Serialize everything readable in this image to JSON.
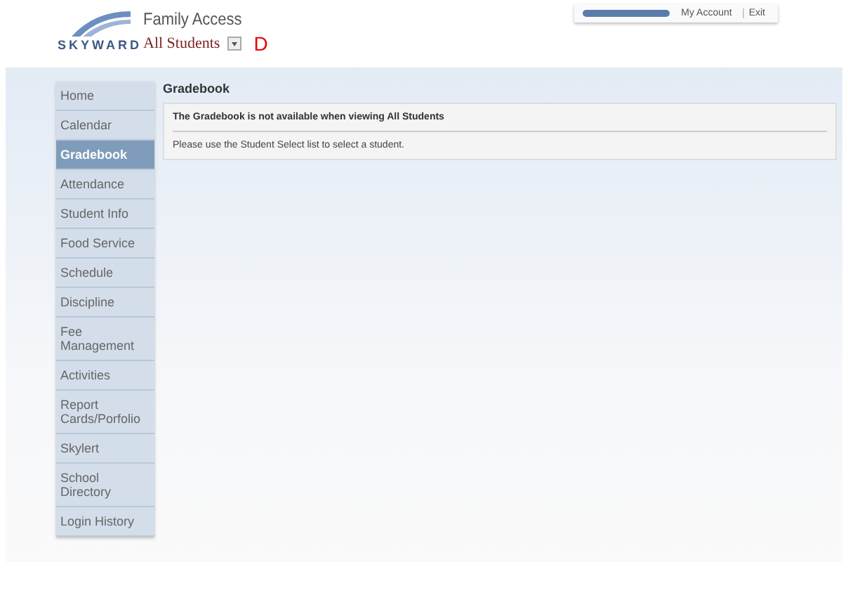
{
  "header": {
    "logo": "SKYWARD",
    "app_title": "Family Access",
    "student_select": "All Students",
    "annotation": "D",
    "account_links": [
      "My Account",
      "Exit"
    ]
  },
  "sidebar": {
    "items": [
      {
        "label": "Home",
        "selected": false
      },
      {
        "label": "Calendar",
        "selected": false
      },
      {
        "label": "Gradebook",
        "selected": true
      },
      {
        "label": "Attendance",
        "selected": false
      },
      {
        "label": "Student Info",
        "selected": false
      },
      {
        "label": "Food Service",
        "selected": false
      },
      {
        "label": "Schedule",
        "selected": false
      },
      {
        "label": "Discipline",
        "selected": false
      },
      {
        "label": "Fee\nManagement",
        "selected": false
      },
      {
        "label": "Activities",
        "selected": false
      },
      {
        "label": "Report\nCards/Porfolio",
        "selected": false
      },
      {
        "label": "Skylert",
        "selected": false
      },
      {
        "label": "School Directory",
        "selected": false
      },
      {
        "label": "Login History",
        "selected": false
      }
    ]
  },
  "content": {
    "title": "Gradebook",
    "message": {
      "heading": "The Gradebook is not available when viewing All Students",
      "text": "Please use the Student Select list to select a student."
    }
  }
}
